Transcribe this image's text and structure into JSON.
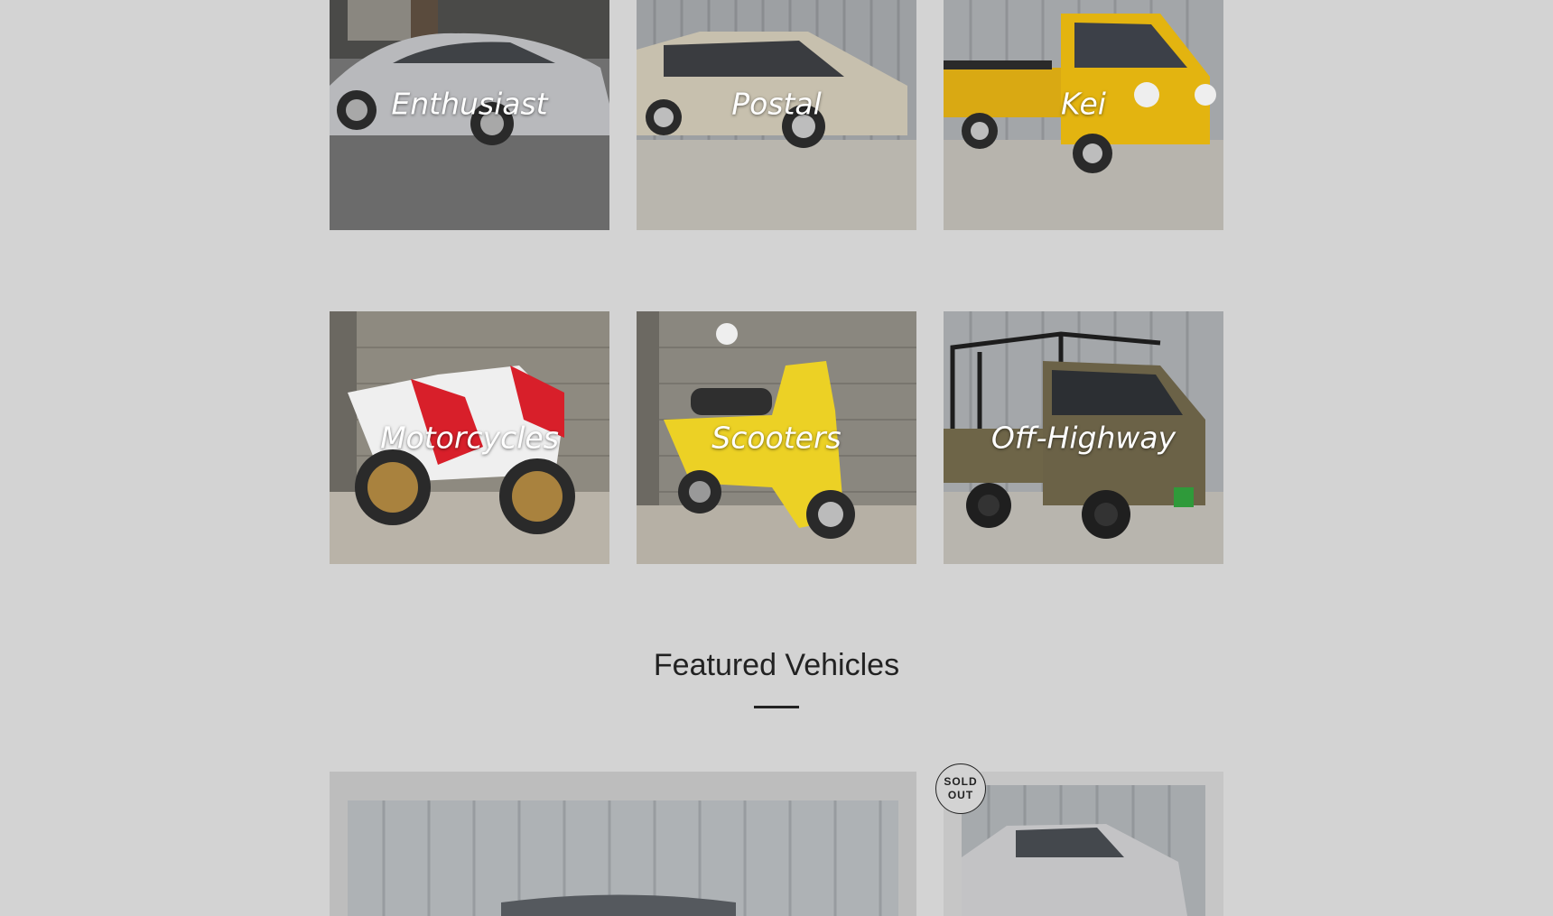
{
  "categories": [
    {
      "label": "Enthusiast"
    },
    {
      "label": "Postal"
    },
    {
      "label": "Kei"
    },
    {
      "label": "Motorcycles"
    },
    {
      "label": "Scooters"
    },
    {
      "label": "Off-Highway"
    }
  ],
  "featured": {
    "title": "Featured Vehicles",
    "cards": [
      {
        "badge": null
      },
      {
        "badge": {
          "line1": "SOLD",
          "line2": "OUT"
        }
      }
    ]
  },
  "colors": {
    "page_bg": "#d3d3d3",
    "text": "#222222",
    "label": "#ffffff"
  }
}
